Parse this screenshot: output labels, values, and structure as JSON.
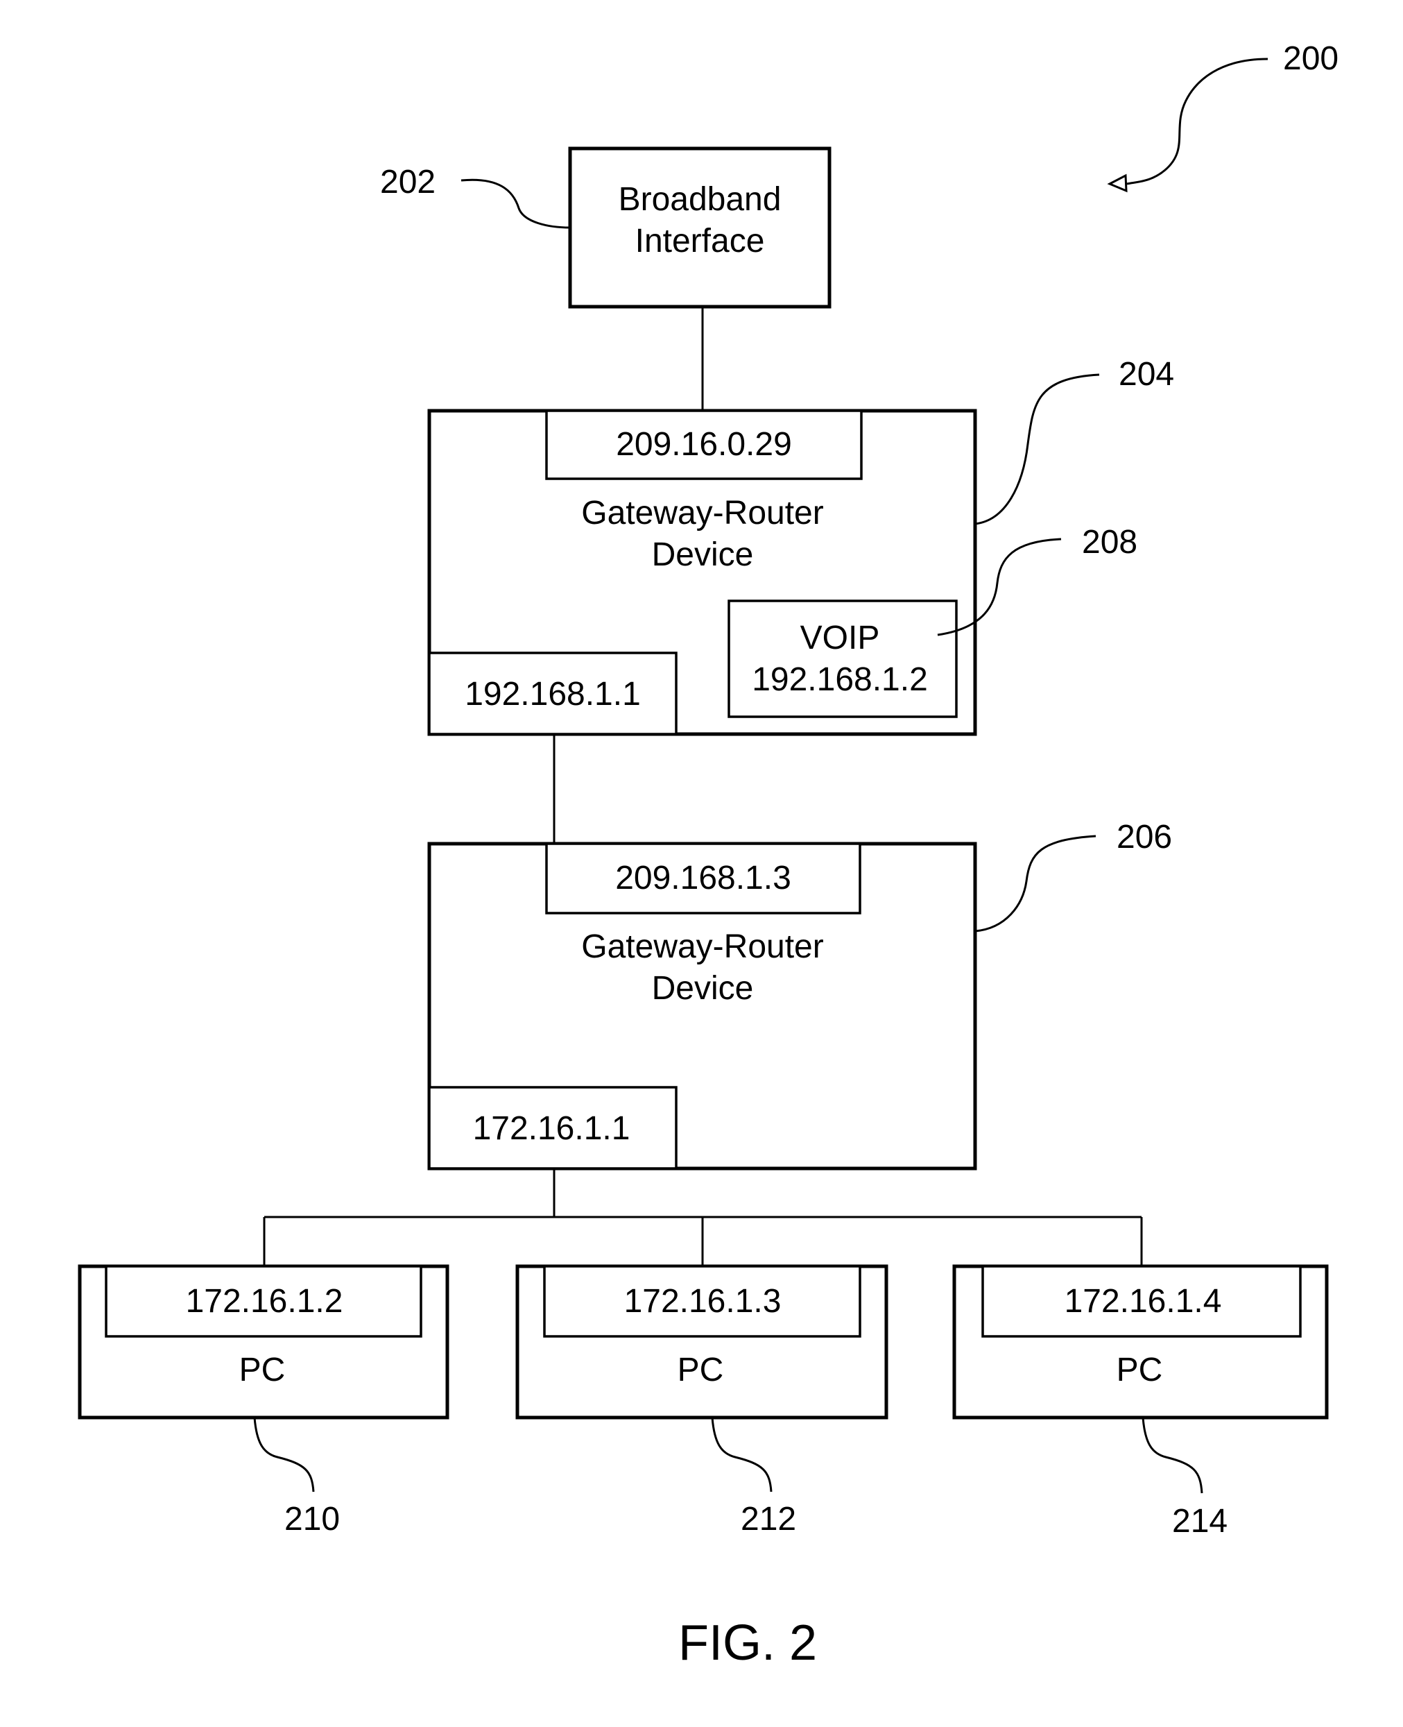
{
  "figure": {
    "caption": "FIG. 2",
    "ref": "200"
  },
  "broadband": {
    "ref": "202",
    "line1": "Broadband",
    "line2": "Interface"
  },
  "router1": {
    "ref": "204",
    "wan_ip": "209.16.0.29",
    "title_line1": "Gateway-Router",
    "title_line2": "Device",
    "lan_ip": "192.168.1.1",
    "voip": {
      "ref": "208",
      "label": "VOIP",
      "ip": "192.168.1.2"
    }
  },
  "router2": {
    "ref": "206",
    "wan_ip": "209.168.1.3",
    "title_line1": "Gateway-Router",
    "title_line2": "Device",
    "lan_ip": "172.16.1.1"
  },
  "pcs": [
    {
      "ref": "210",
      "ip": "172.16.1.2",
      "label": "PC"
    },
    {
      "ref": "212",
      "ip": "172.16.1.3",
      "label": "PC"
    },
    {
      "ref": "214",
      "ip": "172.16.1.4",
      "label": "PC"
    }
  ]
}
